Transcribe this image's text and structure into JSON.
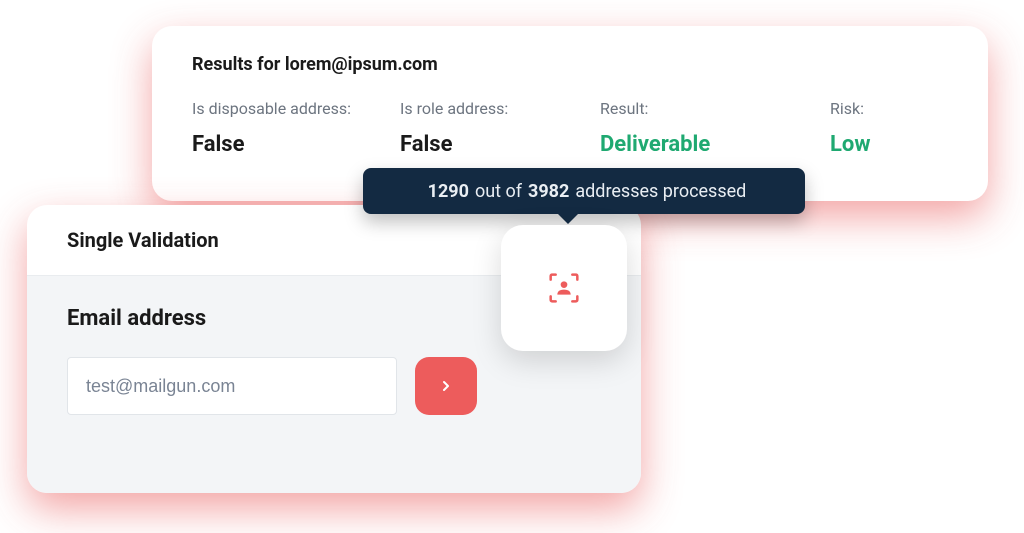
{
  "results": {
    "title": "Results for lorem@ipsum.com",
    "cols": {
      "disposable": {
        "label": "Is disposable address:",
        "value": "False"
      },
      "role": {
        "label": "Is role address:",
        "value": "False"
      },
      "result": {
        "label": "Result:",
        "value": "Deliverable"
      },
      "risk": {
        "label": "Risk:",
        "value": "Low"
      }
    }
  },
  "progress": {
    "count": "1290",
    "mid": " out of ",
    "total": "3982",
    "suffix": " addresses processed"
  },
  "validation": {
    "title": "Single Validation",
    "field_label": "Email address",
    "placeholder": "test@mailgun.com"
  }
}
